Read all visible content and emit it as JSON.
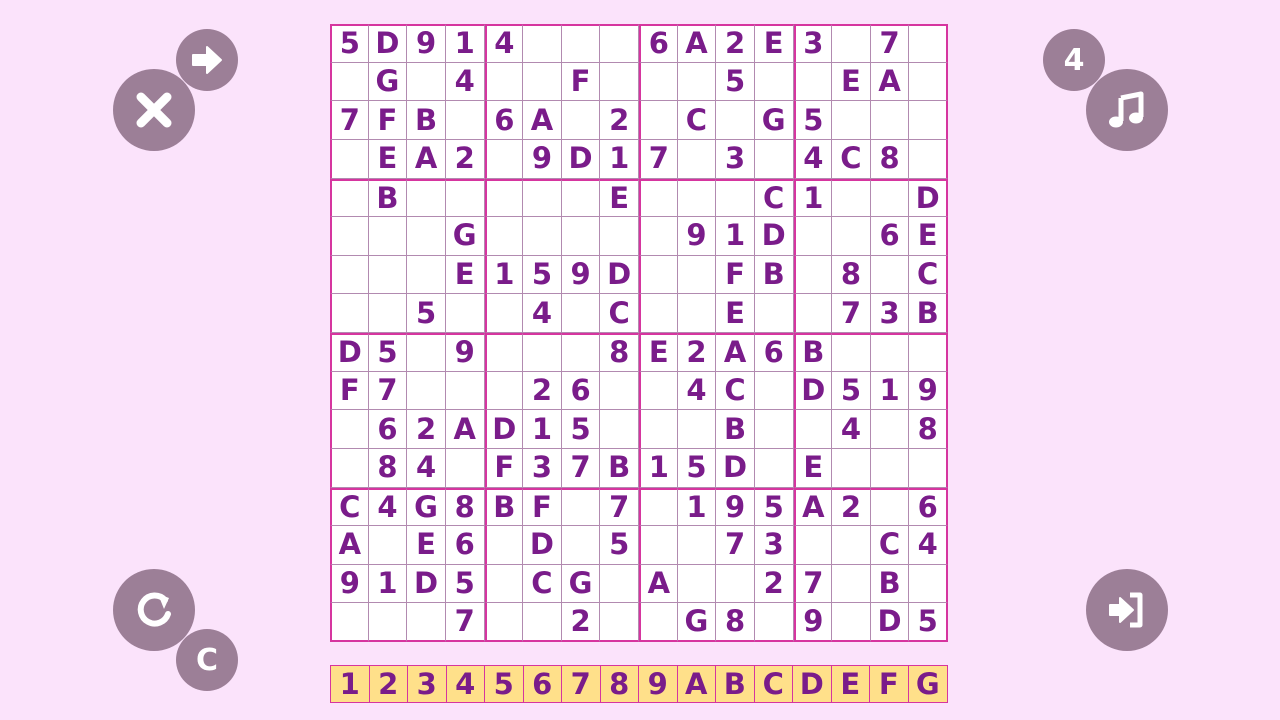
{
  "board": {
    "rows": [
      [
        "5",
        "D",
        "9",
        "1",
        "4",
        "",
        "",
        "",
        "6",
        "A",
        "2",
        "E",
        "3",
        "",
        "7",
        ""
      ],
      [
        "",
        "G",
        "",
        "4",
        "",
        "",
        "F",
        "",
        "",
        "",
        "5",
        "",
        "",
        "E",
        "A",
        ""
      ],
      [
        "7",
        "F",
        "B",
        "",
        "6",
        "A",
        "",
        "2",
        "",
        "C",
        "",
        "G",
        "5",
        "",
        "",
        ""
      ],
      [
        "",
        "E",
        "A",
        "2",
        "",
        "9",
        "D",
        "1",
        "7",
        "",
        "3",
        "",
        "4",
        "C",
        "8",
        ""
      ],
      [
        "",
        "B",
        "",
        "",
        "",
        "",
        "",
        "E",
        "",
        "",
        "",
        "C",
        "1",
        "",
        "",
        "D"
      ],
      [
        "",
        "",
        "",
        "G",
        "",
        "",
        "",
        "",
        "",
        "9",
        "1",
        "D",
        "",
        "",
        "6",
        "E"
      ],
      [
        "",
        "",
        "",
        "E",
        "1",
        "5",
        "9",
        "D",
        "",
        "",
        "F",
        "B",
        "",
        "8",
        "",
        "C"
      ],
      [
        "",
        "",
        "5",
        "",
        "",
        "4",
        "",
        "C",
        "",
        "",
        "E",
        "",
        "",
        "7",
        "3",
        "B"
      ],
      [
        "D",
        "5",
        "",
        "9",
        "",
        "",
        "",
        "8",
        "E",
        "2",
        "A",
        "6",
        "B",
        "",
        "",
        ""
      ],
      [
        "F",
        "7",
        "",
        "",
        "",
        "2",
        "6",
        "",
        "",
        "4",
        "C",
        "",
        "D",
        "5",
        "1",
        "9"
      ],
      [
        "",
        "6",
        "2",
        "A",
        "D",
        "1",
        "5",
        "",
        "",
        "",
        "B",
        "",
        "",
        "4",
        "",
        "8"
      ],
      [
        "",
        "8",
        "4",
        "",
        "F",
        "3",
        "7",
        "B",
        "1",
        "5",
        "D",
        "",
        "E",
        "",
        "",
        ""
      ],
      [
        "C",
        "4",
        "G",
        "8",
        "B",
        "F",
        "",
        "7",
        "",
        "1",
        "9",
        "5",
        "A",
        "2",
        "",
        "6"
      ],
      [
        "A",
        "",
        "E",
        "6",
        "",
        "D",
        "",
        "5",
        "",
        "",
        "7",
        "3",
        "",
        "",
        "C",
        "4"
      ],
      [
        "9",
        "1",
        "D",
        "5",
        "",
        "C",
        "G",
        "",
        "A",
        "",
        "",
        "2",
        "7",
        "",
        "B",
        ""
      ],
      [
        "",
        "",
        "",
        "7",
        "",
        "",
        "2",
        "",
        "",
        "G",
        "8",
        "",
        "9",
        "",
        "D",
        "5"
      ]
    ]
  },
  "palette": [
    "1",
    "2",
    "3",
    "4",
    "5",
    "6",
    "7",
    "8",
    "9",
    "A",
    "B",
    "C",
    "D",
    "E",
    "F",
    "G"
  ],
  "controls": {
    "hint_count": "4",
    "clear_label": "C"
  },
  "icons": {
    "close": "close-icon",
    "forward": "arrow-right-icon",
    "music": "music-note-icon",
    "restart": "restart-icon",
    "exit": "exit-icon"
  },
  "colors": {
    "background": "#fbe3fb",
    "digit": "#7a1c8a",
    "box_border": "#d6359f",
    "button": "#9c7f97",
    "palette_bg": "#ffe08a"
  }
}
